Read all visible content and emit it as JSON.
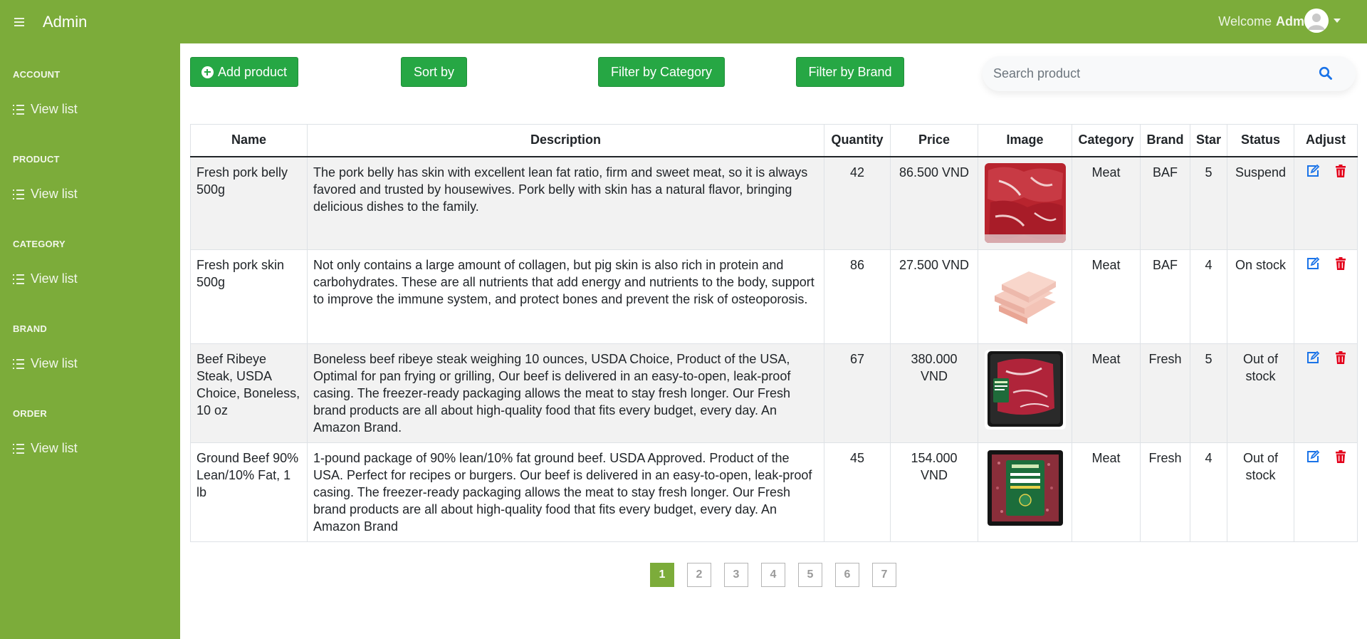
{
  "header": {
    "title": "Admin",
    "welcome_text": "Welcome",
    "user_name": "Admin"
  },
  "sidebar": {
    "sections": [
      {
        "title": "ACCOUNT",
        "item_label": "View list"
      },
      {
        "title": "PRODUCT",
        "item_label": "View list"
      },
      {
        "title": "CATEGORY",
        "item_label": "View list"
      },
      {
        "title": "BRAND",
        "item_label": "View list"
      },
      {
        "title": "ORDER",
        "item_label": "View list"
      }
    ]
  },
  "toolbar": {
    "add_label": "Add product",
    "sort_label": "Sort by",
    "filter_category_label": "Filter by Category",
    "filter_brand_label": "Filter by Brand",
    "search_placeholder": "Search product"
  },
  "table": {
    "columns": [
      "Name",
      "Description",
      "Quantity",
      "Price",
      "Image",
      "Category",
      "Brand",
      "Star",
      "Status",
      "Adjust"
    ],
    "rows": [
      {
        "name": "Fresh pork belly 500g",
        "description": "The pork belly has skin with excellent lean fat ratio, firm and sweet meat, so it is always favored and trusted by housewives. Pork belly with skin has a natural flavor, bringing delicious dishes to the family.",
        "quantity": "42",
        "price": "86.500 VND",
        "category": "Meat",
        "brand": "BAF",
        "star": "5",
        "status": "Suspend"
      },
      {
        "name": "Fresh pork skin 500g",
        "description": "Not only contains a large amount of collagen, but pig skin is also rich in protein and carbohydrates. These are all nutrients that add energy and nutrients to the body, support to improve the immune system, and protect bones and prevent the risk of osteoporosis.",
        "quantity": "86",
        "price": "27.500 VND",
        "category": "Meat",
        "brand": "BAF",
        "star": "4",
        "status": "On stock"
      },
      {
        "name": "Beef Ribeye Steak, USDA Choice, Boneless, 10 oz",
        "description": "Boneless beef ribeye steak weighing 10 ounces, USDA Choice, Product of the USA, Optimal for pan frying or grilling, Our beef is delivered in an easy-to-open, leak-proof casing. The freezer-ready packaging allows the meat to stay fresh longer. Our Fresh brand products are all about high-quality food that fits every budget, every day. An Amazon Brand.",
        "quantity": "67",
        "price": "380.000 VND",
        "category": "Meat",
        "brand": "Fresh",
        "star": "5",
        "status": "Out of stock"
      },
      {
        "name": "Ground Beef 90% Lean/10% Fat, 1 lb",
        "description": "1-pound package of 90% lean/10% fat ground beef. USDA Approved. Product of the USA. Perfect for recipes or burgers. Our beef is delivered in an easy-to-open, leak-proof casing. The freezer-ready packaging allows the meat to stay fresh longer. Our Fresh brand products are all about high-quality food that fits every budget, every day. An Amazon Brand",
        "quantity": "45",
        "price": "154.000 VND",
        "category": "Meat",
        "brand": "Fresh",
        "star": "4",
        "status": "Out of stock"
      }
    ]
  },
  "pagination": {
    "pages": [
      "1",
      "2",
      "3",
      "4",
      "5",
      "6",
      "7"
    ],
    "active": "1"
  },
  "colors": {
    "brand_green": "#7cac3a",
    "button_green": "#26a744",
    "edit_blue": "#1a73e8",
    "delete_red": "#e3001b"
  },
  "icons": [
    "menu-icon",
    "user-avatar-icon",
    "caret-down-icon",
    "list-icon",
    "plus-circle-icon",
    "search-icon",
    "edit-icon",
    "trash-icon"
  ]
}
